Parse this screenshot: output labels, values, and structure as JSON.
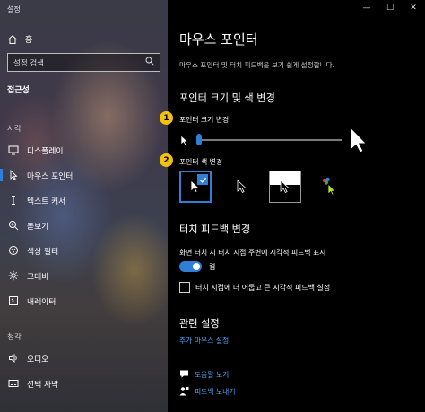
{
  "window": {
    "title": "설정",
    "controls": {
      "minimize": "—",
      "maximize": "☐",
      "close": "✕"
    }
  },
  "sidebar": {
    "home_label": "홈",
    "search_placeholder": "설정 검색",
    "current_section": "접근성",
    "groups": [
      {
        "label": "시각",
        "items": [
          {
            "label": "디스플레이",
            "icon": "monitor-icon"
          },
          {
            "label": "마우스 포인터",
            "icon": "mouse-pointer-icon",
            "active": true
          },
          {
            "label": "텍스트 커서",
            "icon": "text-cursor-icon"
          },
          {
            "label": "돋보기",
            "icon": "magnifier-icon"
          },
          {
            "label": "색상 필터",
            "icon": "color-filter-icon"
          },
          {
            "label": "고대비",
            "icon": "high-contrast-icon"
          },
          {
            "label": "내레이터",
            "icon": "narrator-icon"
          }
        ]
      },
      {
        "label": "청각",
        "items": [
          {
            "label": "오디오",
            "icon": "speaker-icon"
          },
          {
            "label": "선택 자막",
            "icon": "captions-icon"
          }
        ]
      }
    ]
  },
  "main": {
    "title": "마우스 포인터",
    "description": "마우스 포인터 및 터치 피드백을 보기 쉽게 설정합니다.",
    "pointer_section": {
      "heading": "포인터 크기 및 색 변경",
      "size_label": "포인터 크기 변경",
      "size_value": 1,
      "color_label": "포인터 색 변경",
      "color_options": [
        "white",
        "black",
        "inverted",
        "custom"
      ],
      "selected_color": "white",
      "badge1": "1",
      "badge2": "2"
    },
    "touch_section": {
      "heading": "터치 피드백 변경",
      "toggle_desc": "화면 터치 시 터치 지점 주변에 시각적 피드백 표시",
      "toggle_state": "켬",
      "checkbox_label": "터치 지점에 더 어둡고 큰 시각적 피드백 설정",
      "checkbox_checked": false
    },
    "related": {
      "heading": "관련 설정",
      "link": "추가 마우스 설정"
    },
    "help": {
      "get_help": "도움말 보기",
      "feedback": "피드백 보내기"
    }
  },
  "colors": {
    "accent": "#2f7fd8",
    "badge": "#f4c20d",
    "link": "#4aa3f0"
  }
}
